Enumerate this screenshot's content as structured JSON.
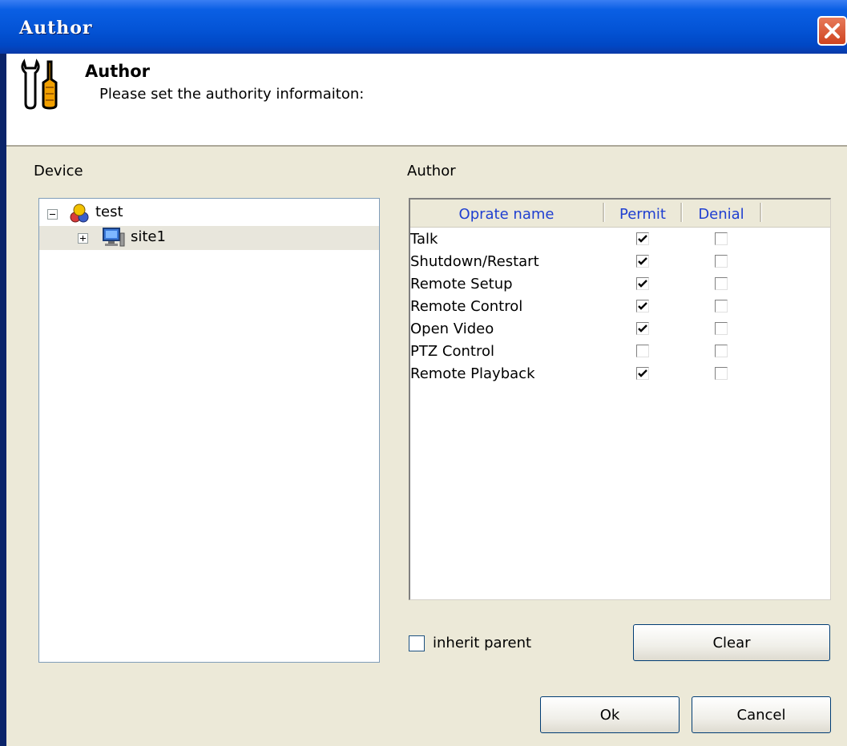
{
  "window": {
    "title": "Author"
  },
  "header": {
    "title": "Author",
    "subtitle": "Please set the authority informaiton:"
  },
  "device": {
    "label": "Device",
    "tree": [
      {
        "label": "test",
        "expanded": true,
        "icon": "user-group-icon"
      },
      {
        "label": "site1",
        "expanded": false,
        "icon": "computer-icon",
        "selected": true
      }
    ]
  },
  "author": {
    "label": "Author",
    "columns": [
      "Oprate name",
      "Permit",
      "Denial"
    ],
    "rows": [
      {
        "name": "Talk",
        "permit": true,
        "denial": false
      },
      {
        "name": "Shutdown/Restart",
        "permit": true,
        "denial": false
      },
      {
        "name": "Remote Setup",
        "permit": true,
        "denial": false
      },
      {
        "name": "Remote Control",
        "permit": true,
        "denial": false
      },
      {
        "name": "Open Video",
        "permit": true,
        "denial": false
      },
      {
        "name": "PTZ Control",
        "permit": false,
        "denial": false
      },
      {
        "name": "Remote Playback",
        "permit": true,
        "denial": false
      }
    ]
  },
  "inherit": {
    "label": "inherit parent",
    "checked": false
  },
  "buttons": {
    "clear": "Clear",
    "ok": "Ok",
    "cancel": "Cancel"
  },
  "colors": {
    "titlebar": "#0454d6",
    "close": "#d9532c",
    "accent_text": "#1f3fd1",
    "dialog_bg": "#ece9d8"
  }
}
